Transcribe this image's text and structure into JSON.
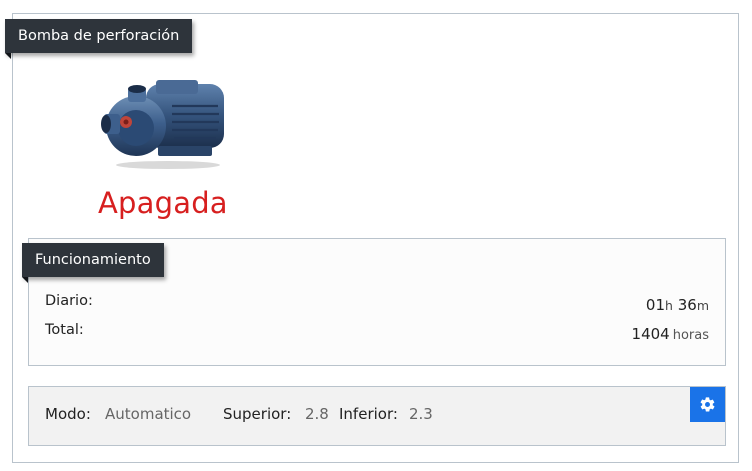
{
  "card": {
    "title": "Bomba de perforación"
  },
  "pump": {
    "status": "Apagada",
    "status_color": "#d71f1f",
    "image_icon": "water-pump-icon"
  },
  "operation": {
    "title": "Funcionamiento",
    "daily_label": "Diario:",
    "daily_hours": "01",
    "hours_unit": "h",
    "daily_minutes": "36",
    "minutes_unit": "m",
    "total_label": "Total:",
    "total_value": "1404",
    "total_unit": "horas"
  },
  "mode": {
    "mode_label": "Modo:",
    "mode_value": "Automatico",
    "upper_label": "Superior:",
    "upper_value": "2.8",
    "lower_label": "Inferior:",
    "lower_value": "2.3",
    "settings_icon": "gear-icon",
    "settings_button_color": "#1a73e8"
  }
}
